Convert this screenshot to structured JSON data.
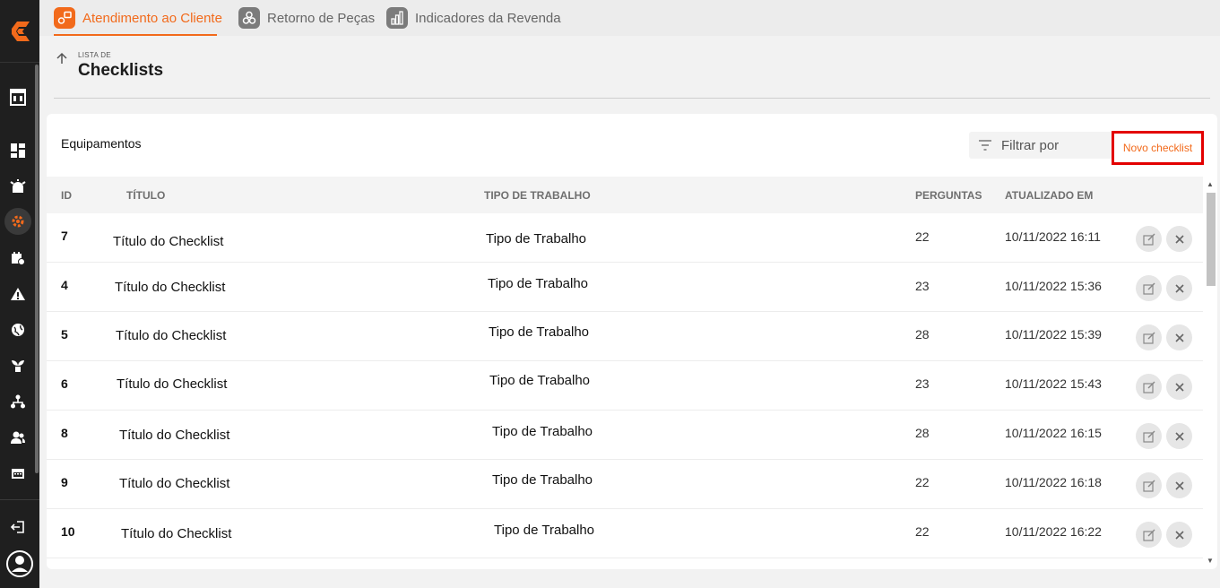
{
  "tabs": [
    {
      "label": "Atendimento ao Cliente",
      "active": true
    },
    {
      "label": "Retorno de Peças",
      "active": false
    },
    {
      "label": "Indicadores da Revenda",
      "active": false
    }
  ],
  "header": {
    "breadcrumb": "LISTA DE",
    "title": "Checklists"
  },
  "card": {
    "title": "Equipamentos",
    "filter_label": "Filtrar por",
    "new_button_label": "Novo checklist"
  },
  "table": {
    "columns": [
      "ID",
      "TÍTULO",
      "TIPO DE TRABALHO",
      "PERGUNTAS",
      "ATUALIZADO EM"
    ],
    "rows": [
      {
        "id": "7",
        "title": "Título do Checklist",
        "work_type": "Tipo de Trabalho",
        "questions": "22",
        "updated": "10/11/2022 16:11"
      },
      {
        "id": "4",
        "title": "Título do Checklist",
        "work_type": "Tipo de Trabalho",
        "questions": "23",
        "updated": "10/11/2022 15:36"
      },
      {
        "id": "5",
        "title": "Título do Checklist",
        "work_type": "Tipo de Trabalho",
        "questions": "28",
        "updated": "10/11/2022 15:39"
      },
      {
        "id": "6",
        "title": "Título do Checklist",
        "work_type": "Tipo de Trabalho",
        "questions": "23",
        "updated": "10/11/2022 15:43"
      },
      {
        "id": "8",
        "title": "Título do Checklist",
        "work_type": "Tipo de Trabalho",
        "questions": "28",
        "updated": "10/11/2022 16:15"
      },
      {
        "id": "9",
        "title": "Título do Checklist",
        "work_type": "Tipo de Trabalho",
        "questions": "22",
        "updated": "10/11/2022 16:18"
      },
      {
        "id": "10",
        "title": "Título do Checklist",
        "work_type": "Tipo de Trabalho",
        "questions": "22",
        "updated": "10/11/2022 16:22"
      }
    ]
  },
  "colors": {
    "accent": "#f26a1b",
    "highlight": "#e30000",
    "sidebar": "#1f1f1f"
  },
  "sidebar_icons": [
    "store-icon",
    "dashboard-icon",
    "alarm-icon",
    "gear-icon",
    "calendar-icon",
    "warning-icon",
    "globe-icon",
    "plant-icon",
    "org-chart-icon",
    "users-icon",
    "calendar-grid-icon",
    "logout-icon",
    "user-avatar-icon"
  ]
}
